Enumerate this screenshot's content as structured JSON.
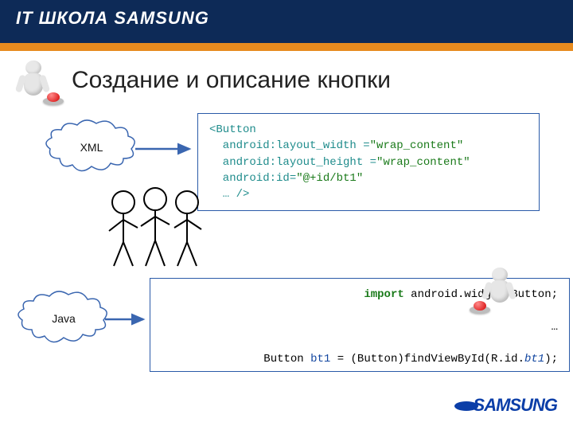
{
  "header": {
    "brand": "IT ШКОЛА SAMSUNG"
  },
  "slide": {
    "title": "Создание и описание кнопки",
    "clouds": {
      "xml": "XML",
      "java": "Java"
    }
  },
  "xml_code": {
    "l1a": "<",
    "l1b": "Button",
    "l2a": "  android:layout_width =",
    "l2b": "\"wrap_content\"",
    "l3a": "  android:layout_height =",
    "l3b": "\"wrap_content\"",
    "l4a": "  android:id=",
    "l4b": "\"@+id/bt1\"",
    "l5": "  … />"
  },
  "java_code": {
    "l1a": "import",
    "l1b": " android.widget.Button;",
    "l2": "…",
    "l3a": "Button ",
    "l3b": "bt1",
    "l3c": " = (Button)findViewById(R.id.",
    "l3d": "bt1",
    "l3e": ");"
  },
  "footer": {
    "logo": "SAMSUNG"
  }
}
